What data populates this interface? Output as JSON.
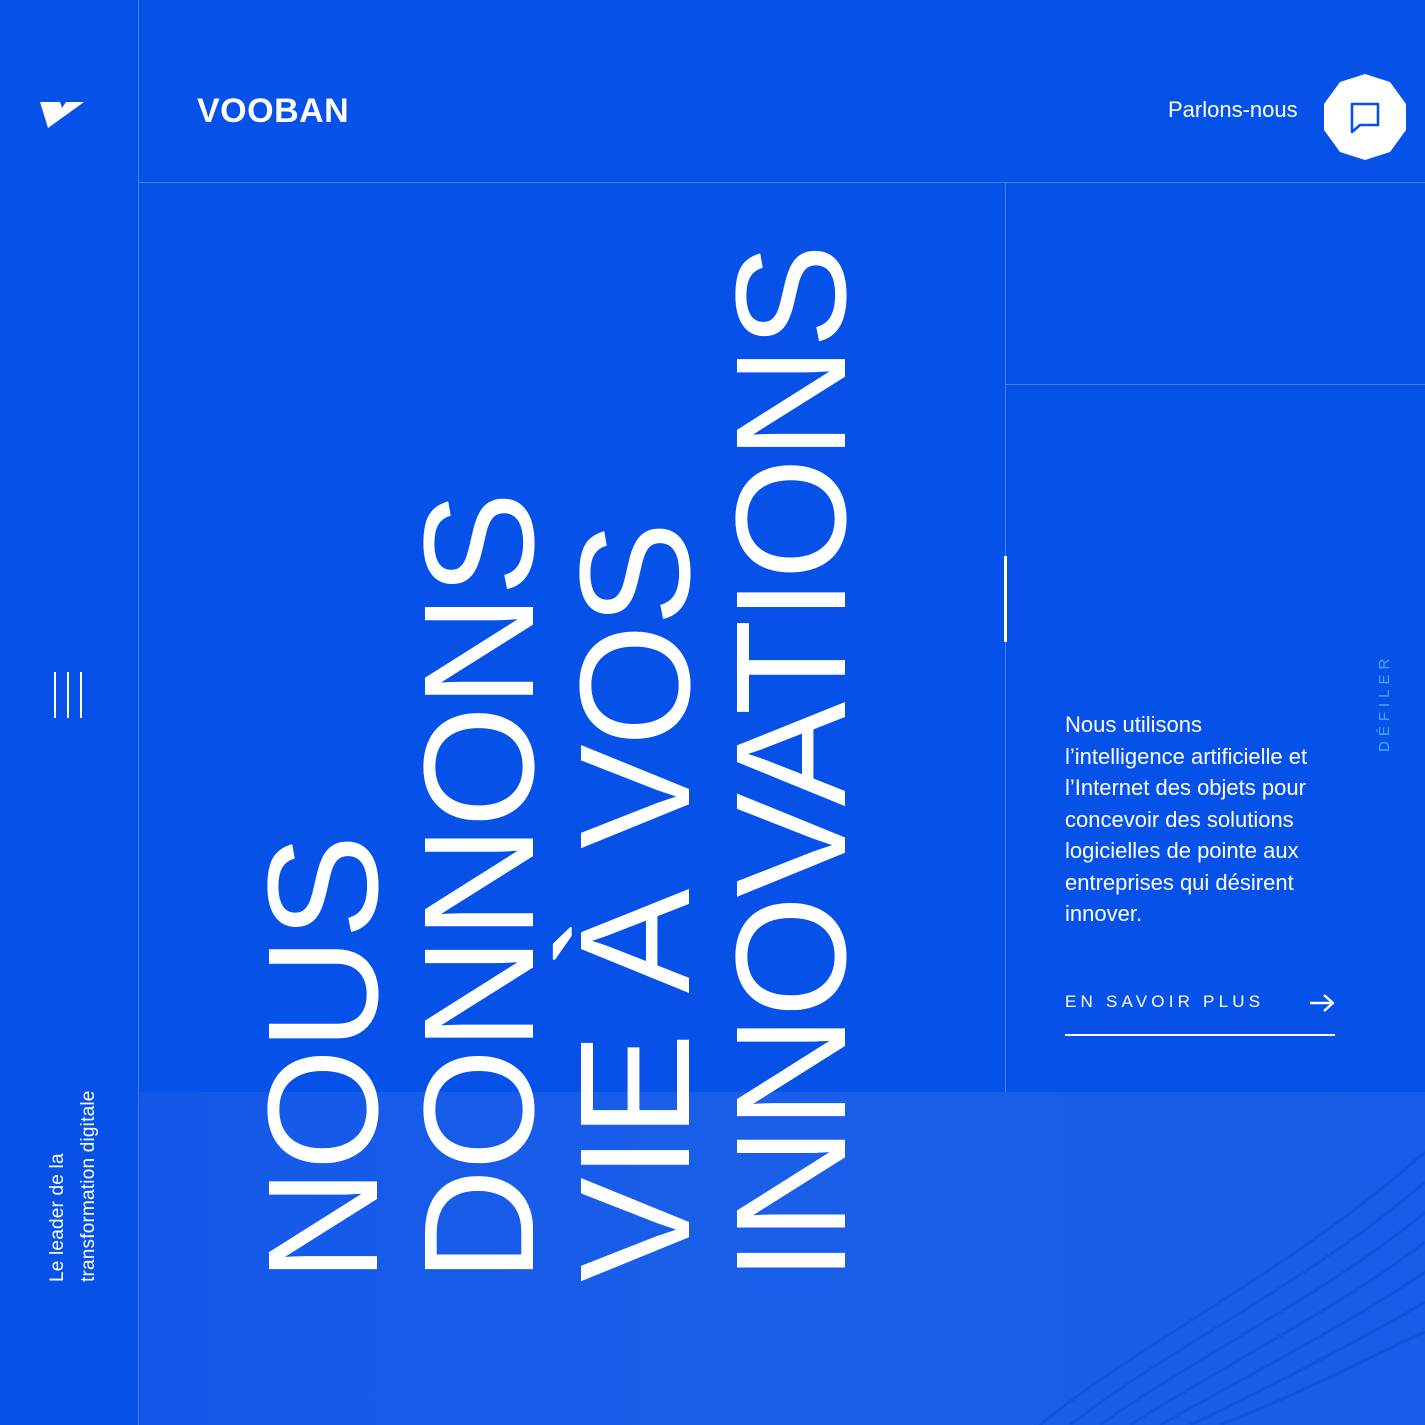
{
  "brand": {
    "name": "VOOBAN"
  },
  "sidebar": {
    "tagline_line1": "Le leader de la",
    "tagline_line2": "transformation digitale"
  },
  "header": {
    "contact_label": "Parlons-nous"
  },
  "hero": {
    "headline": [
      "NOUS",
      "DONNONS",
      "VIE À VOS",
      "INNOVATIONS"
    ],
    "description": "Nous utilisons l’intelligence artificielle et l’Internet des objets pour concevoir des solutions logicielles de pointe aux entreprises qui désirent innover.",
    "cta_label": "EN SAVOIR PLUS",
    "scroll_label": "DÉFILER"
  },
  "colors": {
    "background": "#0652e8",
    "accent": "#3ab0ff",
    "text": "#ffffff"
  },
  "icons": {
    "logo": "vooban-logo-icon",
    "menu": "menu-bars-icon",
    "chat": "chat-bubble-icon",
    "arrow": "arrow-right-icon"
  }
}
